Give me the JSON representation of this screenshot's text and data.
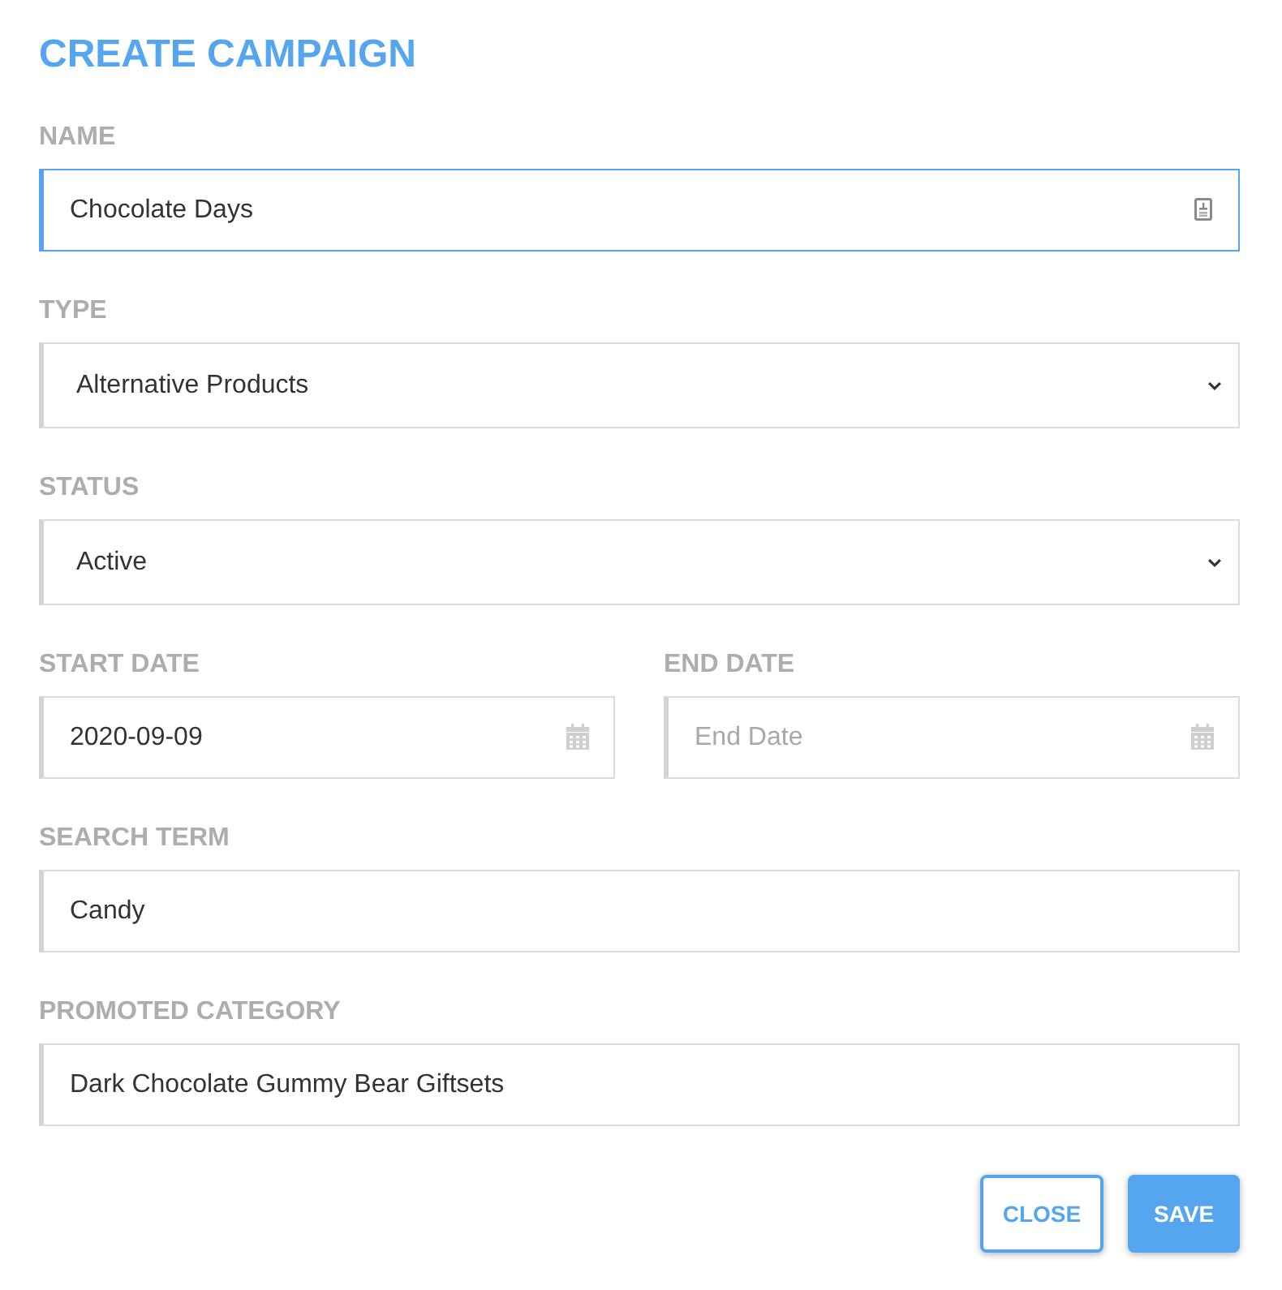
{
  "title": "CREATE CAMPAIGN",
  "rows": [
    {
      "fields": [
        {
          "kind": "autofill",
          "label": "NAME",
          "value": "Chocolate Days",
          "focused": true
        }
      ]
    },
    {
      "fields": [
        {
          "kind": "select",
          "label": "TYPE",
          "value": "Alternative Products",
          "focused": false
        }
      ]
    },
    {
      "fields": [
        {
          "kind": "select",
          "label": "STATUS",
          "value": "Active",
          "focused": false
        }
      ]
    },
    {
      "fields": [
        {
          "kind": "date",
          "label": "START DATE",
          "value": "2020-09-09",
          "focused": false
        },
        {
          "kind": "date",
          "label": "END DATE",
          "placeholder": "End Date",
          "focused": false
        }
      ]
    },
    {
      "fields": [
        {
          "kind": "text",
          "label": "SEARCH TERM",
          "value": "Candy",
          "focused": false
        }
      ]
    },
    {
      "fields": [
        {
          "kind": "text",
          "label": "PROMOTED CATEGORY",
          "value": "Dark Chocolate Gummy Bear Giftsets",
          "focused": false
        }
      ]
    }
  ],
  "buttons": [
    {
      "label": "CLOSE",
      "kind": "outline"
    },
    {
      "label": "SAVE",
      "kind": "primary"
    }
  ]
}
